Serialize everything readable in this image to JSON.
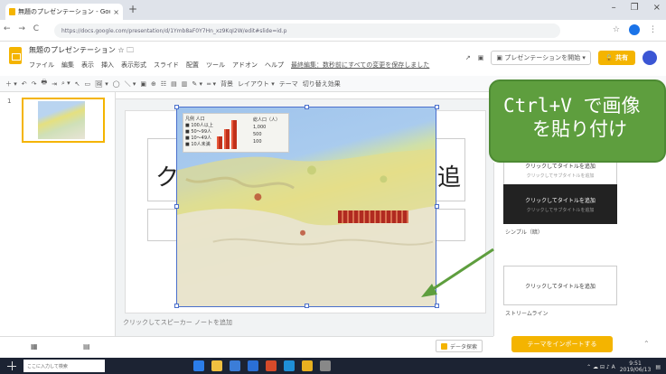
{
  "browser": {
    "tab_title": "無題のプレゼンテーション - Google ス",
    "tab_close": "×",
    "new_tab": "+",
    "window_controls": [
      "–",
      "❐",
      "×"
    ],
    "nav_buttons": "← → C",
    "url": "https://docs.google.com/presentation/d/1Ymb8aF0Y7Hn_xz9KqI2W/edit#slide=id.p",
    "profile_color": "#1a73e8"
  },
  "app": {
    "doc_title": "無題のプレゼンテーション ☆ 🗀",
    "menus": [
      "ファイル",
      "編集",
      "表示",
      "挿入",
      "表示形式",
      "スライド",
      "配置",
      "ツール",
      "アドオン",
      "ヘルプ"
    ],
    "last_edit": "最終編集：数秒前にすべての変更を保存しました",
    "present_label": "▣ プレゼンテーションを開始 ▾",
    "share_label": "🔒 共有",
    "accent_color": "#f4b400"
  },
  "toolbar": {
    "items": [
      "＋ ▾",
      "↶",
      "↷",
      "🖶",
      "⇥",
      "⌕ ▾",
      "↖",
      "▭",
      "🖼 ▾",
      "◯",
      "＼ ▾",
      "▣",
      "⊕",
      "☷",
      "▤",
      "▥",
      "✎ ▾",
      "═ ▾",
      "背景",
      "レイアウト ▾",
      "テーマ",
      "切り替え効果"
    ]
  },
  "filmstrip": {
    "slide_number": "1",
    "thumb_text": "クリックしてタイトルを追加"
  },
  "slide": {
    "title_glyphs": [
      "ク",
      "追"
    ],
    "notes_placeholder": "クリックしてスピーカー ノートを追加"
  },
  "pasted_image": {
    "legend_lines": [
      "凡例 人口",
      "■ 100人以上",
      "■ 50～99人",
      "■ 10～49人",
      "■ 10人未満"
    ],
    "legend_right": [
      "総人口（人）",
      "1,000",
      "500",
      "100"
    ]
  },
  "callout": {
    "line1": "Ctrl+V で画像",
    "line2": "を貼り付け",
    "color": "#5e9e3e"
  },
  "themes": {
    "items": [
      {
        "label": "シンプル（明）",
        "card_title": "クリックしてタイトルを追加",
        "card_sub": "クリックしてサブタイトルを追加",
        "style": "light"
      },
      {
        "label": "シンプル（暗）",
        "card_title": "クリックしてタイトルを追加",
        "card_sub": "クリックしてサブタイトルを追加",
        "style": "dark"
      },
      {
        "label": "ストリームライン",
        "card_title": "クリックしてタイトルを追加",
        "card_sub": "",
        "style": "light"
      }
    ],
    "import_button": "テーマをインポートする"
  },
  "bottom": {
    "explore_label": "データ探索",
    "view_icons": [
      "▦",
      "▤"
    ]
  },
  "taskbar": {
    "search_placeholder": "ここに入力して検索",
    "tray_text": "⌃ ☁ ⊟ ♪ A",
    "clock_time": "9:51",
    "clock_date": "2019/06/13",
    "icons": [
      "edge-icon",
      "explorer-icon",
      "store-icon",
      "mail-icon",
      "office-icon",
      "photos-icon",
      "chrome-icon",
      "app-icon"
    ]
  }
}
